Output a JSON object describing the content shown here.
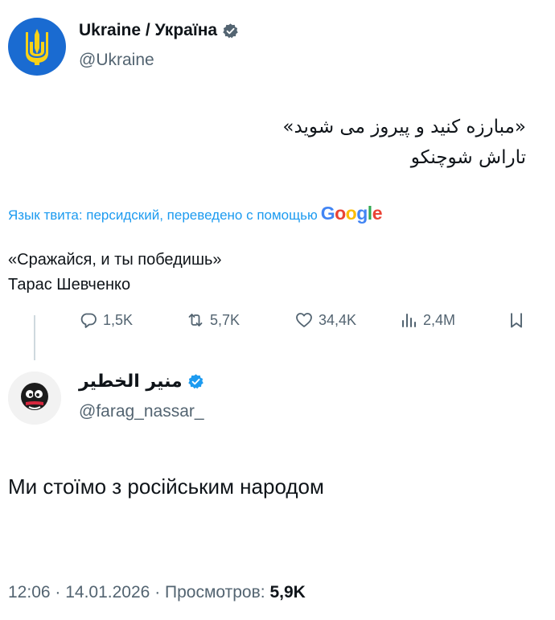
{
  "tweet1": {
    "author_name": "Ukraine / Україна",
    "handle": "@Ukraine",
    "text_fa_line1": "«مبارزه کنید و پیروز می شوید»",
    "text_fa_line2": "تاراش شوچنکو",
    "translation_note": "Язык твита: персидский, переведено с помощью",
    "translation_brand": "Google",
    "translated_line1": "«Сражайся, и ты победишь»",
    "translated_line2": "Тарас Шевченко",
    "stats": {
      "replies": "1,5K",
      "retweets": "5,7K",
      "likes": "34,4K",
      "views": "2,4M"
    }
  },
  "tweet2": {
    "author_name": "منير الخطير",
    "handle": "@farag_nassar_",
    "text": "Ми стоїмо з російським народом",
    "time": "12:06",
    "date": "14.01.2026",
    "views_label": "Просмотров:",
    "views_value": "5,9K"
  },
  "colors": {
    "verified": "#1d9bf0",
    "link": "#1d9bf0",
    "muted": "#536471",
    "ukraine_blue": "#1a6bd1",
    "ukraine_gold": "#f7d117"
  },
  "icons": {
    "reply": "reply-icon",
    "retweet": "retweet-icon",
    "like": "heart-icon",
    "views": "views-icon",
    "bookmark": "bookmark-icon",
    "verified": "verified-badge-icon"
  }
}
